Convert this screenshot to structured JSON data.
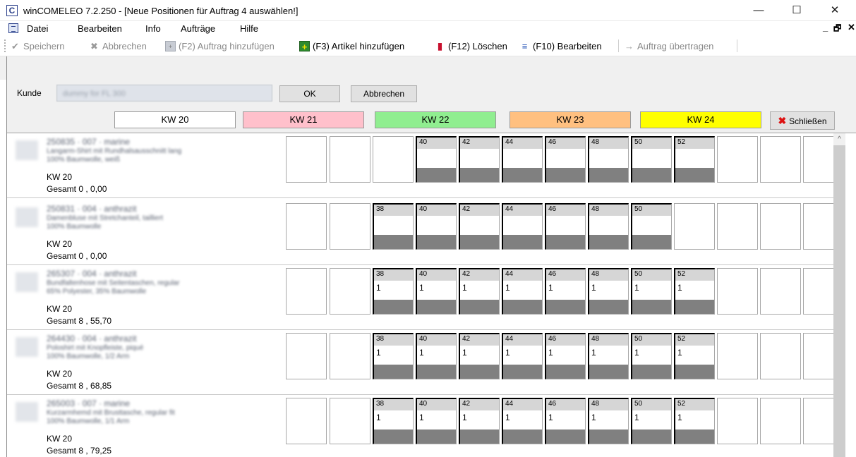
{
  "window": {
    "app_icon": "C",
    "title": "winCOMELEO 7.2.250 - [Neue Positionen für Auftrag 4 auswählen!]",
    "minimize": "—",
    "maximize": "☐",
    "close": "✕"
  },
  "menu": {
    "items": [
      "Datei",
      "Bearbeiten",
      "Info",
      "Aufträge",
      "Hilfe"
    ],
    "mdi_min": "_",
    "mdi_restore": "🗗",
    "mdi_close": "✕"
  },
  "toolbar": {
    "save": "Speichern",
    "cancel": "Abbrechen",
    "add_order": "(F2) Auftrag hinzufügen",
    "add_article": "(F3) Artikel hinzufügen",
    "delete": "(F12) Löschen",
    "edit": "(F10) Bearbeiten",
    "transfer": "Auftrag übertragen"
  },
  "header": {
    "kunde_label": "Kunde",
    "kunde_value": "dummy for FL 300",
    "ok": "OK",
    "abbrechen": "Abbrechen",
    "schliessen": "Schließen",
    "weeks": [
      {
        "label": "KW 20",
        "color": "#ffffff"
      },
      {
        "label": "KW 21",
        "color": "#ffc0cb"
      },
      {
        "label": "KW 22",
        "color": "#90ee90"
      },
      {
        "label": "KW 23",
        "color": "#ffc080"
      },
      {
        "label": "KW 24",
        "color": "#ffff00"
      }
    ]
  },
  "rows": [
    {
      "art_no": "250835 · 007 · marine",
      "desc1": "Langarm-Shirt mit Rundhalsausschnitt lang",
      "desc2": "100% Baumwolle, weiß",
      "kw": "KW 20",
      "total": "Gesamt 0 ,  0,00",
      "sizes": [
        null,
        null,
        null,
        "40",
        "42",
        "44",
        "46",
        "48",
        "50",
        "52",
        null,
        null,
        null
      ],
      "qty": [
        null,
        null,
        null,
        "",
        "",
        "",
        "",
        "",
        "",
        "",
        null,
        null,
        null
      ]
    },
    {
      "art_no": "250831 · 004 · anthrazit",
      "desc1": "Damenbluse mit Stretchanteil, tailliert",
      "desc2": "100% Baumwolle",
      "kw": "KW 20",
      "total": "Gesamt 0 ,  0,00",
      "sizes": [
        null,
        null,
        "38",
        "40",
        "42",
        "44",
        "46",
        "48",
        "50",
        null,
        null,
        null,
        null
      ],
      "qty": [
        null,
        null,
        "",
        "",
        "",
        "",
        "",
        "",
        "",
        null,
        null,
        null,
        null
      ]
    },
    {
      "art_no": "265307 · 004 · anthrazit",
      "desc1": "Bundfaltenhose mit Seitentaschen, regular",
      "desc2": "65% Polyester, 35% Baumwolle",
      "kw": "KW 20",
      "total": "Gesamt 8 ,  55,70",
      "sizes": [
        null,
        null,
        "38",
        "40",
        "42",
        "44",
        "46",
        "48",
        "50",
        "52",
        null,
        null,
        null
      ],
      "qty": [
        null,
        null,
        "1",
        "1",
        "1",
        "1",
        "1",
        "1",
        "1",
        "1",
        null,
        null,
        null
      ]
    },
    {
      "art_no": "264430 · 004 · anthrazit",
      "desc1": "Poloshirt mit Knopfleiste, piqué",
      "desc2": "100% Baumwolle, 1/2 Arm",
      "kw": "KW 20",
      "total": "Gesamt 8 ,  68,85",
      "sizes": [
        null,
        null,
        "38",
        "40",
        "42",
        "44",
        "46",
        "48",
        "50",
        "52",
        null,
        null,
        null
      ],
      "qty": [
        null,
        null,
        "1",
        "1",
        "1",
        "1",
        "1",
        "1",
        "1",
        "1",
        null,
        null,
        null
      ]
    },
    {
      "art_no": "265003 · 007 · marine",
      "desc1": "Kurzarmhemd mit Brusttasche, regular fit",
      "desc2": "100% Baumwolle, 1/1 Arm",
      "kw": "KW 20",
      "total": "Gesamt 8 ,  79,25",
      "sizes": [
        null,
        null,
        "38",
        "40",
        "42",
        "44",
        "46",
        "48",
        "50",
        "52",
        null,
        null,
        null
      ],
      "qty": [
        null,
        null,
        "1",
        "1",
        "1",
        "1",
        "1",
        "1",
        "1",
        "1",
        null,
        null,
        null
      ]
    }
  ],
  "scroll_up_glyph": "^"
}
